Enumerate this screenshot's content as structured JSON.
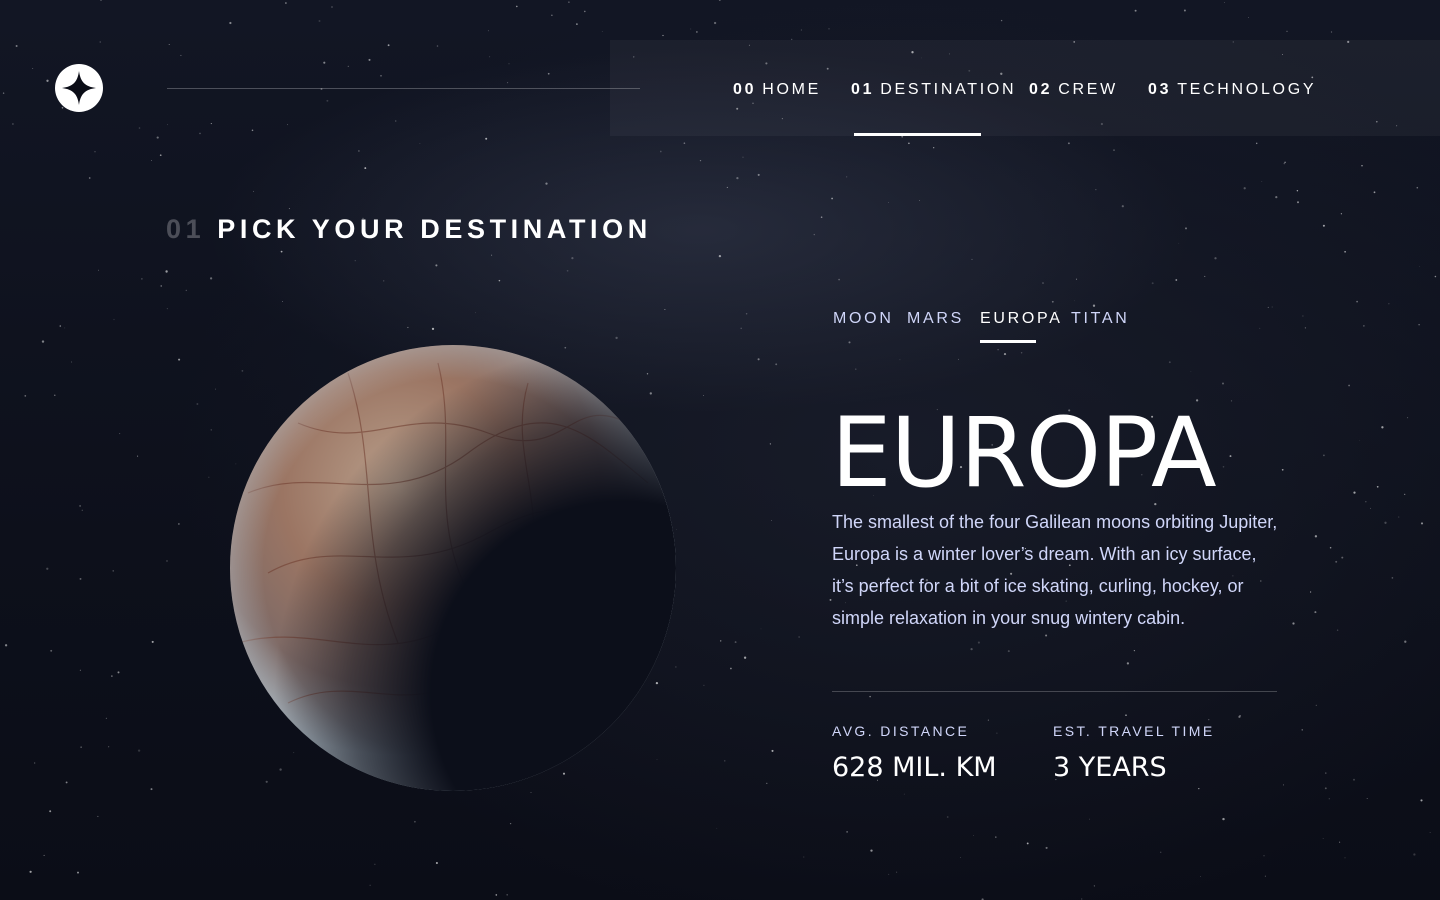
{
  "header": {
    "logo_icon": "star-logo-icon",
    "nav": [
      {
        "num": "00",
        "label": "HOME"
      },
      {
        "num": "01",
        "label": "DESTINATION"
      },
      {
        "num": "02",
        "label": "CREW"
      },
      {
        "num": "03",
        "label": "TECHNOLOGY"
      }
    ],
    "active_nav": "01 DESTINATION"
  },
  "main": {
    "heading_num": "01",
    "heading": "PICK YOUR DESTINATION",
    "tabs": [
      "MOON",
      "MARS",
      "EUROPA",
      "TITAN"
    ],
    "active_tab": "EUROPA",
    "destination": {
      "name": "EUROPA",
      "description": "The smallest of the four Galilean moons orbiting Jupiter, Europa is a winter lover’s dream. With an icy surface, it’s perfect for a bit of ice skating, curling, hockey, or simple relaxation in your snug wintery cabin.",
      "stats": [
        {
          "label": "AVG. DISTANCE",
          "value": "628 MIL. KM"
        },
        {
          "label": "EST. TRAVEL TIME",
          "value": "3 YEARS"
        }
      ]
    }
  },
  "colors": {
    "background": "#0b0d17",
    "text_light": "#d0d6f9",
    "white": "#ffffff"
  }
}
